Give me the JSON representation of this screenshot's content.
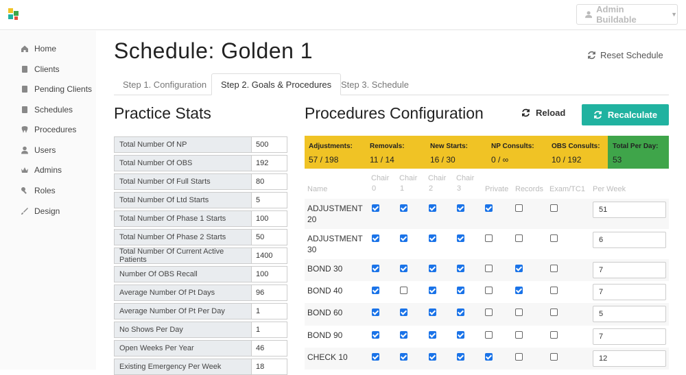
{
  "header": {
    "user_label": "Admin Buildable"
  },
  "colors": {
    "accent": "#20b2a0",
    "summary_bg": "#f0c325",
    "total_bg": "#3fa54a",
    "checkbox": "#1a73e8"
  },
  "sidebar": {
    "items": [
      {
        "label": "Home",
        "icon": "home-icon"
      },
      {
        "label": "Clients",
        "icon": "clients-icon"
      },
      {
        "label": "Pending Clients",
        "icon": "pending-clients-icon"
      },
      {
        "label": "Schedules",
        "icon": "schedules-icon"
      },
      {
        "label": "Procedures",
        "icon": "tooth-icon"
      },
      {
        "label": "Users",
        "icon": "user-icon"
      },
      {
        "label": "Admins",
        "icon": "crown-icon"
      },
      {
        "label": "Roles",
        "icon": "key-icon"
      },
      {
        "label": "Design",
        "icon": "brush-icon"
      }
    ]
  },
  "page": {
    "title": "Schedule: Golden 1",
    "reset_label": "Reset Schedule"
  },
  "tabs": [
    {
      "label": "Step 1. Configuration",
      "active": false
    },
    {
      "label": "Step 2. Goals & Procedures",
      "active": true
    },
    {
      "label": "Step 3. Schedule",
      "active": false
    }
  ],
  "practice_stats": {
    "title": "Practice Stats",
    "rows": [
      {
        "label": "Total Number Of NP",
        "value": "500"
      },
      {
        "label": "Total Number Of OBS",
        "value": "192"
      },
      {
        "label": "Total Number Of Full Starts",
        "value": "80"
      },
      {
        "label": "Total Number Of Ltd Starts",
        "value": "5"
      },
      {
        "label": "Total Number Of Phase 1 Starts",
        "value": "100"
      },
      {
        "label": "Total Number Of Phase 2 Starts",
        "value": "50"
      },
      {
        "label": "Total Number Of Current Active Patients",
        "value": "1400"
      },
      {
        "label": "Number Of OBS Recall",
        "value": "100"
      },
      {
        "label": "Average Number Of Pt Days",
        "value": "96"
      },
      {
        "label": "Average Number Of Pt Per Day",
        "value": "1"
      },
      {
        "label": "No Shows Per Day",
        "value": "1"
      },
      {
        "label": "Open Weeks Per Year",
        "value": "46"
      },
      {
        "label": "Existing Emergency Per Week",
        "value": "18"
      }
    ]
  },
  "procedures": {
    "title": "Procedures Configuration",
    "reload_label": "Reload",
    "recalculate_label": "Recalculate",
    "summary": [
      {
        "label": "Adjustments:",
        "value": "57 / 198"
      },
      {
        "label": "Removals:",
        "value": "11 / 14"
      },
      {
        "label": "New Starts:",
        "value": "16 / 30"
      },
      {
        "label": "NP Consults:",
        "value": "0 / ∞"
      },
      {
        "label": "OBS Consults:",
        "value": "10 / 192"
      },
      {
        "label": "Total Per Day:",
        "value": "53"
      }
    ],
    "columns": {
      "name": "Name",
      "chairs": [
        {
          "line1": "Chair",
          "line2": "0"
        },
        {
          "line1": "Chair",
          "line2": "1"
        },
        {
          "line1": "Chair",
          "line2": "2"
        },
        {
          "line1": "Chair",
          "line2": "3"
        }
      ],
      "private": "Private",
      "records": "Records",
      "exam": "Exam/TC1",
      "per_week": "Per Week"
    },
    "rows": [
      {
        "name": "ADJUSTMENT 20",
        "checks": [
          true,
          true,
          true,
          true,
          true,
          false,
          false
        ],
        "per_week": "51"
      },
      {
        "name": "ADJUSTMENT 30",
        "checks": [
          true,
          true,
          true,
          true,
          false,
          false,
          false
        ],
        "per_week": "6"
      },
      {
        "name": "BOND 30",
        "checks": [
          true,
          true,
          true,
          true,
          false,
          true,
          false
        ],
        "per_week": "7"
      },
      {
        "name": "BOND 40",
        "checks": [
          true,
          false,
          true,
          true,
          false,
          true,
          false
        ],
        "per_week": "7"
      },
      {
        "name": "BOND 60",
        "checks": [
          true,
          true,
          true,
          true,
          false,
          false,
          false
        ],
        "per_week": "5"
      },
      {
        "name": "BOND 90",
        "checks": [
          true,
          true,
          true,
          true,
          false,
          false,
          false
        ],
        "per_week": "7"
      },
      {
        "name": "CHECK 10",
        "checks": [
          true,
          true,
          true,
          true,
          true,
          false,
          false
        ],
        "per_week": "12"
      }
    ]
  }
}
